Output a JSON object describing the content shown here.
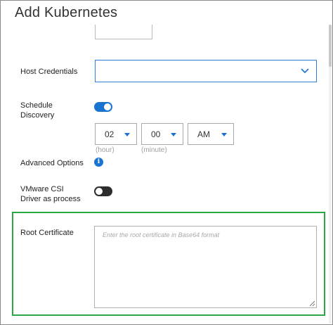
{
  "dialog": {
    "title": "Add Kubernetes"
  },
  "fields": {
    "host_credentials": {
      "label": "Host Credentials",
      "value": ""
    },
    "schedule_discovery": {
      "label_line1": "Schedule",
      "label_line2": "Discovery",
      "enabled": true,
      "hour": "02",
      "minute": "00",
      "ampm": "AM",
      "hour_hint": "(hour)",
      "minute_hint": "(minute)"
    },
    "advanced_options": {
      "label": "Advanced Options",
      "icon": "info-icon"
    },
    "vmware_csi": {
      "label_line1": "VMware CSI",
      "label_line2": "Driver as process",
      "enabled": false
    },
    "root_certificate": {
      "label": "Root Certificate",
      "placeholder": "Enter the root certificate in Base64 format",
      "value": ""
    }
  },
  "colors": {
    "accent": "#1a73d0",
    "highlight_border": "#2aa844",
    "toggle_off": "#2e2e2e"
  }
}
